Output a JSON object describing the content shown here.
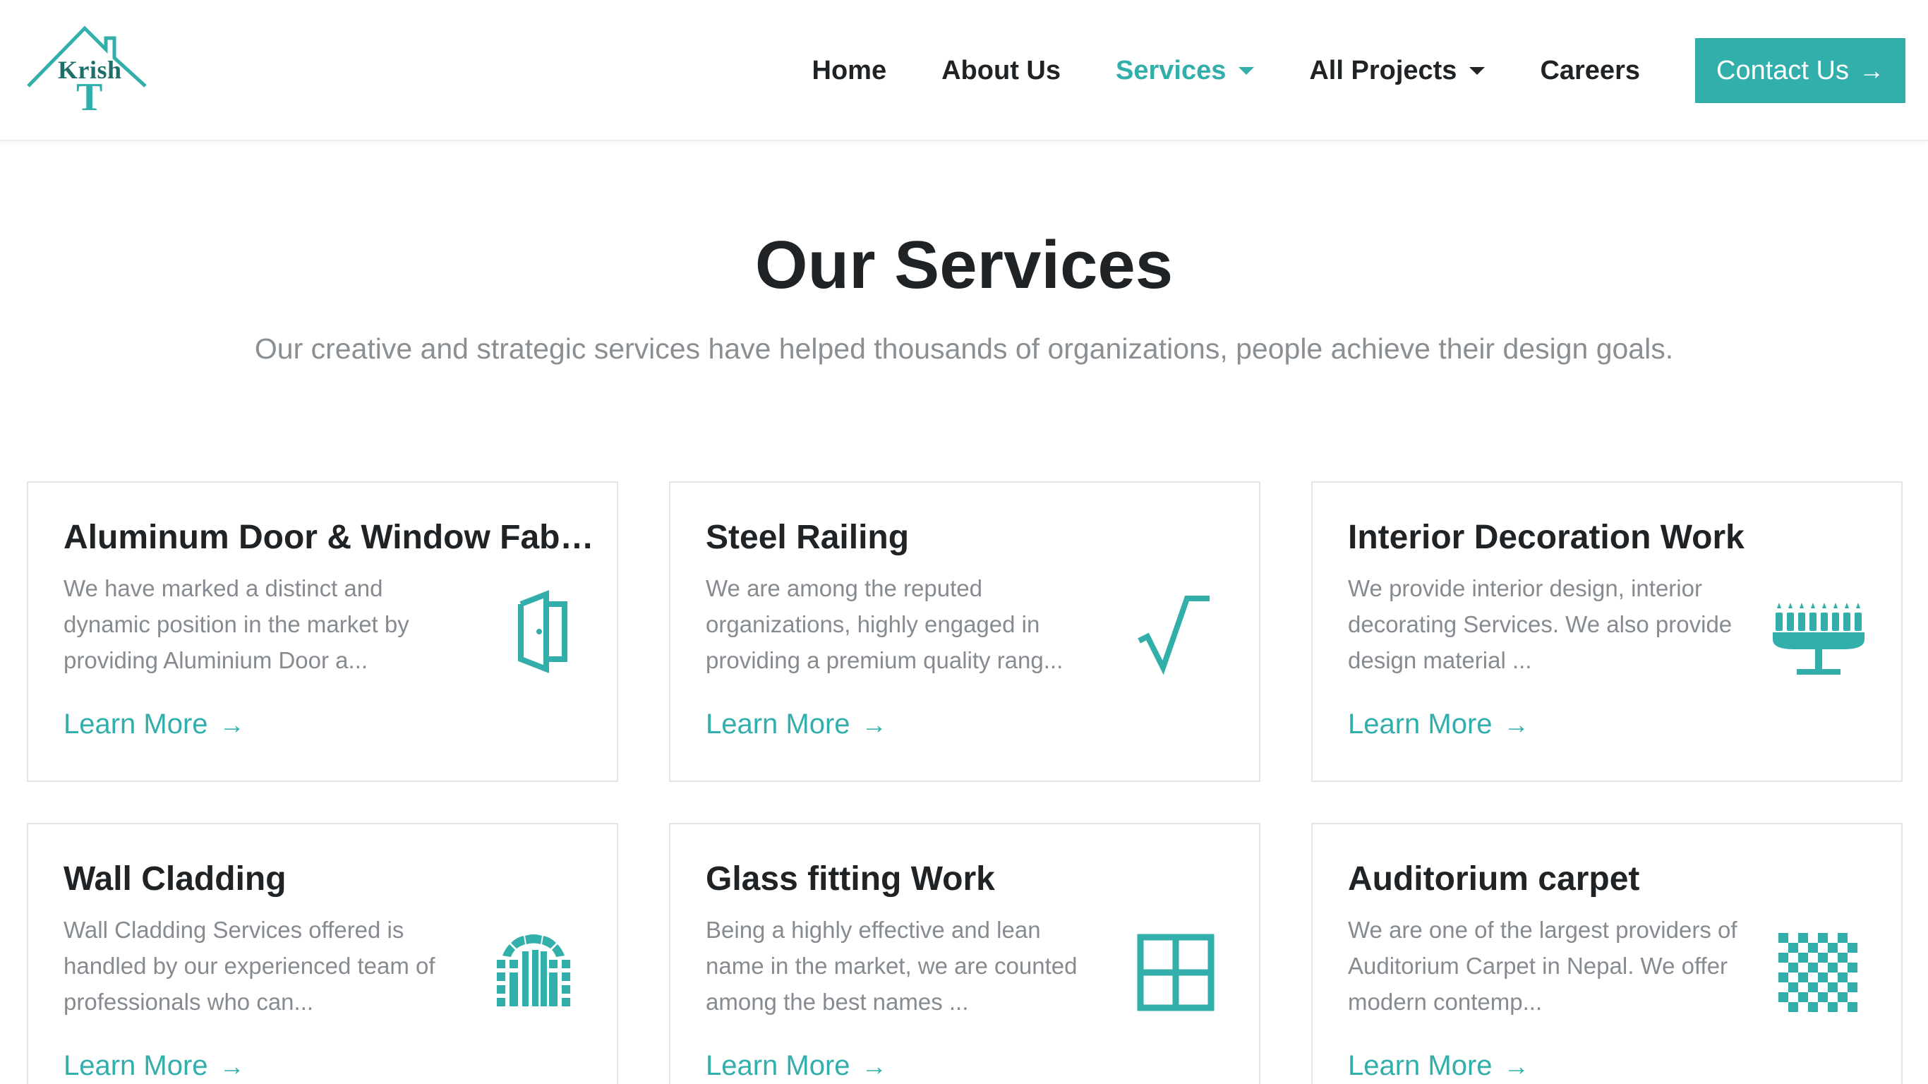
{
  "brand": {
    "logo_text": "Krish",
    "logo_letter": "T",
    "accent_color": "#32aeab"
  },
  "nav": {
    "items": [
      {
        "label": "Home",
        "active": false,
        "dropdown": false
      },
      {
        "label": "About Us",
        "active": false,
        "dropdown": false
      },
      {
        "label": "Services",
        "active": true,
        "dropdown": true
      },
      {
        "label": "All Projects",
        "active": false,
        "dropdown": true
      },
      {
        "label": "Careers",
        "active": false,
        "dropdown": false
      }
    ],
    "contact_label": "Contact Us",
    "contact_arrow": "→"
  },
  "section": {
    "title": "Our Services",
    "subtitle": "Our creative and strategic services have helped thousands of organizations, people achieve their design goals."
  },
  "services": [
    {
      "title": "Aluminum Door & Window Fabrication",
      "description": "We have marked a distinct and dynamic position in the market by providing Aluminium Door a...",
      "link_label": "Learn More",
      "arrow": "→",
      "icon": "door-icon"
    },
    {
      "title": "Steel Railing",
      "description": "We are among the reputed organizations, highly engaged in providing a premium quality rang...",
      "link_label": "Learn More",
      "arrow": "→",
      "icon": "square-root-icon"
    },
    {
      "title": "Interior Decoration Work",
      "description": "We provide interior design, interior decorating Services. We also provide design material ...",
      "link_label": "Learn More",
      "arrow": "→",
      "icon": "menorah-icon"
    },
    {
      "title": "Wall Cladding",
      "description": "Wall Cladding Services offered is handled by our experienced team of professionals who can...",
      "link_label": "Learn More",
      "arrow": "→",
      "icon": "arch-icon"
    },
    {
      "title": "Glass fitting Work",
      "description": "Being a highly effective and lean name in the market, we are counted among the best names ...",
      "link_label": "Learn More",
      "arrow": "→",
      "icon": "window-icon"
    },
    {
      "title": "Auditorium carpet",
      "description": "We are one of the largest providers of Auditorium Carpet in Nepal. We offer modern contemp...",
      "link_label": "Learn More",
      "arrow": "→",
      "icon": "checkerboard-icon"
    }
  ]
}
